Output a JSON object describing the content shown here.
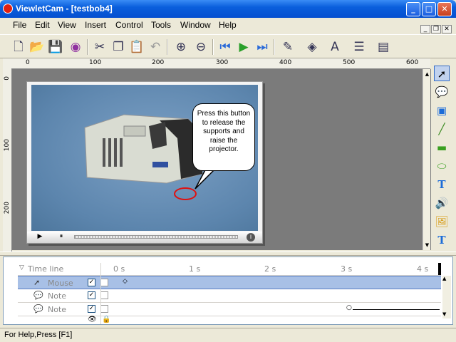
{
  "window": {
    "title": "ViewletCam - [testbob4]"
  },
  "menu": [
    "File",
    "Edit",
    "View",
    "Insert",
    "Control",
    "Tools",
    "Window",
    "Help"
  ],
  "ruler": {
    "h": [
      "0",
      "100",
      "200",
      "300",
      "400",
      "500",
      "600"
    ],
    "v": [
      "0",
      "100",
      "200"
    ]
  },
  "callout": {
    "text": "Press this button to release the supports and raise the projector."
  },
  "timeline": {
    "header": "Time line",
    "ticks": [
      "0 s",
      "1 s",
      "2 s",
      "3 s",
      "4 s"
    ],
    "rows": [
      {
        "label": "Mouse",
        "checked": true
      },
      {
        "label": "Note",
        "checked": true
      },
      {
        "label": "Note",
        "checked": true
      }
    ]
  },
  "status": {
    "text": "For Help,Press [F1]"
  },
  "colors": {
    "titlebar": "#0a5fdc",
    "canvas": "#7b7b7b",
    "highlight_ring": "#e01010",
    "selected_row": "#a8c0e6"
  }
}
